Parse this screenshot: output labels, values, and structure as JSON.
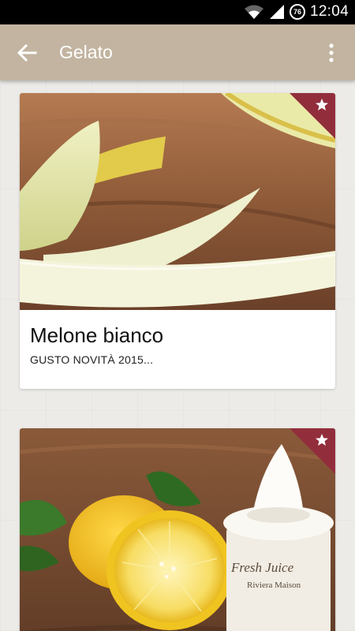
{
  "status_bar": {
    "time": "12:04",
    "battery_level": "76"
  },
  "app_bar": {
    "title": "Gelato"
  },
  "cards": [
    {
      "title": "Melone bianco",
      "subtitle": "GUSTO NOVITÀ 2015...",
      "featured": true
    },
    {
      "title": "",
      "subtitle": "",
      "featured": true
    }
  ],
  "product_image": {
    "jar_text_1": "Fresh Juice",
    "jar_text_2": "Riviera Maison"
  },
  "colors": {
    "app_bar": "#c2b4a0",
    "ribbon": "#922e3c",
    "status_bar": "#000000"
  },
  "icons": [
    "back-arrow-icon",
    "overflow-menu-icon",
    "wifi-icon",
    "signal-icon",
    "star-icon"
  ]
}
